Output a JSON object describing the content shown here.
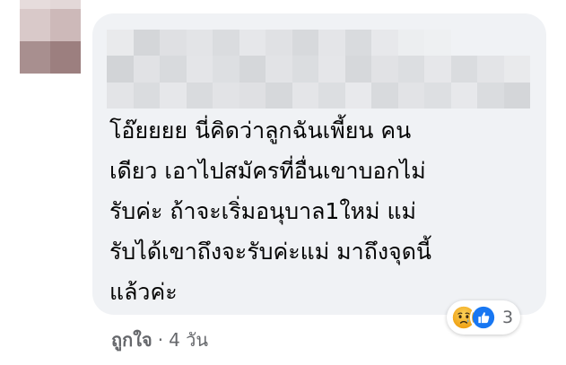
{
  "comment": {
    "text_lines": [
      "โอ๊ยยยย นี่คิดว่าลูกฉันเพี้ยน คน",
      "เดียว เอาไปสมัครที่อื่นเขาบอกไม่",
      "รับค่ะ ถ้าจะเริ่มอนุบาล1ใหม่ แม่",
      "รับได้เขาถึงจะรับค่ะแม่ มาถึงจุดนี้",
      "แล้วค่ะ"
    ],
    "reactions": {
      "icons": [
        "sad-icon",
        "like-icon"
      ],
      "count": "3"
    },
    "actions": {
      "like_label": "ถูกใจ",
      "separator": "·",
      "timestamp": "4 วัน"
    }
  },
  "colors": {
    "bubble_bg": "#f0f2f5",
    "text": "#050505",
    "secondary_text": "#65676b",
    "like_blue": "#1877f2",
    "sad_yellow": "#f7b125"
  }
}
